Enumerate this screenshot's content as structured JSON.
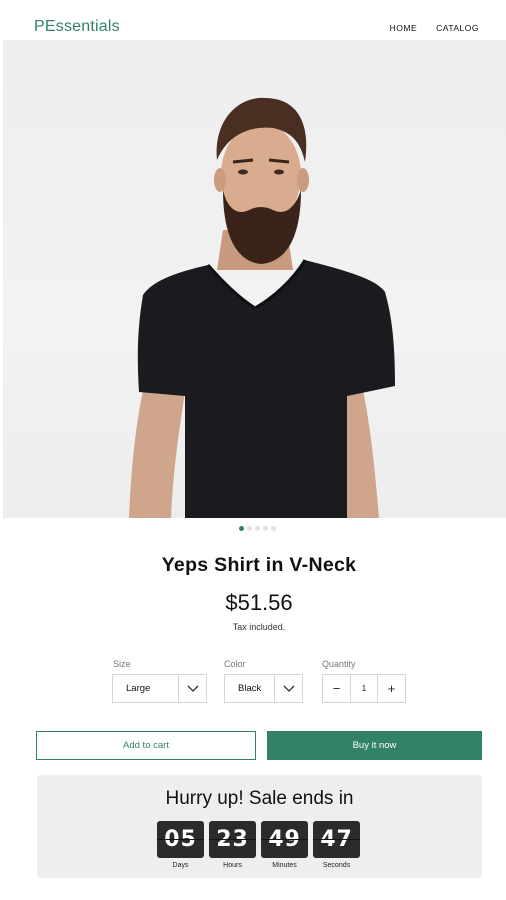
{
  "header": {
    "logo": "PEssentials",
    "nav": [
      {
        "label": "HOME"
      },
      {
        "label": "CATALOG"
      }
    ]
  },
  "gallery": {
    "image": "product-photo",
    "slide_count": 5,
    "active_slide": 1
  },
  "product": {
    "title": "Yeps Shirt in V-Neck",
    "price": "$51.56",
    "tax_note": "Tax included."
  },
  "options": {
    "size": {
      "label": "Size",
      "value": "Large"
    },
    "color": {
      "label": "Color",
      "value": "Black"
    },
    "quantity": {
      "label": "Quantity",
      "value": "1",
      "minus": "−",
      "plus": "+"
    }
  },
  "actions": {
    "add_to_cart": "Add to cart",
    "buy_now": "Buy it now"
  },
  "sale": {
    "title": "Hurry up! Sale ends in",
    "countdown": [
      {
        "value": "05",
        "label": "Days"
      },
      {
        "value": "23",
        "label": "Hours"
      },
      {
        "value": "49",
        "label": "Minutes"
      },
      {
        "value": "47",
        "label": "Seconds"
      }
    ]
  },
  "colors": {
    "accent": "#338168",
    "timer_bg": "#2b2b2b",
    "panel_bg": "#eeeeee"
  }
}
